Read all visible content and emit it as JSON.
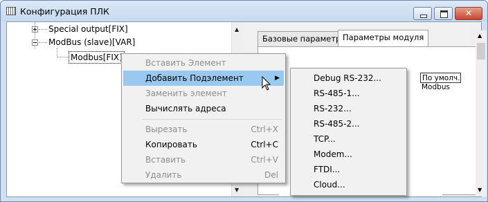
{
  "window": {
    "title": "Конфигурация ПЛК"
  },
  "tree": {
    "nodes": [
      {
        "label": "Special output[FIX]"
      },
      {
        "label": "ModBus (slave)[VAR]"
      },
      {
        "label": "Modbus[FIX]"
      }
    ]
  },
  "tabs": [
    {
      "label": "Базовые параметры"
    },
    {
      "label": "Параметры модуля"
    }
  ],
  "grid": {
    "header": "По умолч.",
    "value": "Modbus"
  },
  "context_menu": {
    "items": [
      {
        "label": "Вставить Элемент",
        "shortcut": ""
      },
      {
        "label": "Добавить Подэлемент",
        "shortcut": ""
      },
      {
        "label": "Заменить элемент",
        "shortcut": ""
      },
      {
        "label": "Вычислять адреса",
        "shortcut": ""
      },
      {
        "label": "Вырезать",
        "shortcut": "Ctrl+X"
      },
      {
        "label": "Копировать",
        "shortcut": "Ctrl+C"
      },
      {
        "label": "Вставить",
        "shortcut": "Ctrl+V"
      },
      {
        "label": "Удалить",
        "shortcut": "Del"
      }
    ]
  },
  "submenu": {
    "items": [
      {
        "label": "Debug RS-232..."
      },
      {
        "label": "RS-485-1..."
      },
      {
        "label": "RS-232..."
      },
      {
        "label": "RS-485-2..."
      },
      {
        "label": "TCP..."
      },
      {
        "label": "Modem..."
      },
      {
        "label": "FTDI..."
      },
      {
        "label": "Cloud..."
      }
    ]
  },
  "colors": {
    "highlight": "#99c9ef",
    "close_button": "#c9462c"
  }
}
